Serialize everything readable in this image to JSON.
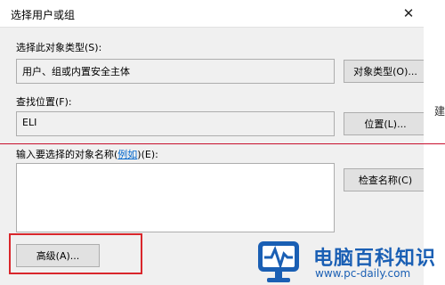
{
  "window": {
    "title": "选择用户或组"
  },
  "object_type": {
    "label": "选择此对象类型(S):",
    "value": "用户、组或内置安全主体",
    "button": "对象类型(O)..."
  },
  "location": {
    "label": "查找位置(F):",
    "value": "ELI",
    "button": "位置(L)..."
  },
  "names": {
    "label_prefix": "输入要选择的对象名称(",
    "label_link": "例如",
    "label_suffix": ")(E):",
    "value": "",
    "check_button": "检查名称(C)"
  },
  "advanced_button": "高级(A)...",
  "right_fragment": "建",
  "watermark": {
    "title": "电脑百科知识",
    "url": "www.pc-daily.com"
  },
  "colors": {
    "annotation_red": "#d9262b",
    "link_blue": "#0066cc",
    "logo_blue": "#1a5fb4"
  }
}
